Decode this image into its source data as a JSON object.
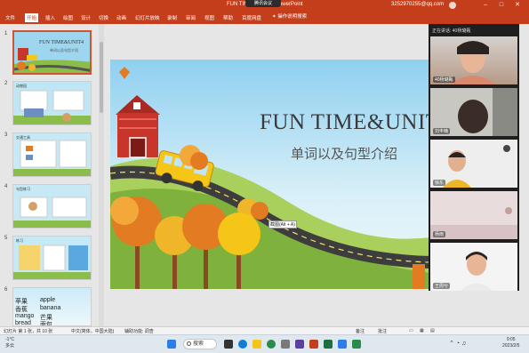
{
  "window": {
    "title": "FUN TIME&UNIT4 - PowerPoint",
    "user": "3252970255@qq.com"
  },
  "meeting": {
    "label": "腾讯会议"
  },
  "ribbon": {
    "tabs": [
      "文件",
      "开始",
      "插入",
      "绘图",
      "设计",
      "切换",
      "动画",
      "幻灯片放映",
      "录制",
      "审阅",
      "视图",
      "帮助",
      "百度网盘"
    ],
    "active_tab": "开始",
    "search": "操作说明搜索"
  },
  "thumbnails": [
    {
      "num": "1",
      "title": "FUN TIME&UNIT4",
      "subtitle": "单词以及句型介绍"
    },
    {
      "num": "2",
      "title": "动物园"
    },
    {
      "num": "3",
      "title": "交通工具"
    },
    {
      "num": "4",
      "title": "句型练习"
    },
    {
      "num": "5",
      "title": "练习"
    },
    {
      "num": "6",
      "words": [
        "苹果",
        "apple",
        "香蕉",
        "banana",
        "mango",
        "芒果",
        "bread",
        "面包"
      ]
    }
  ],
  "slide": {
    "title": "FUN TIME&UNIT4",
    "subtitle": "单词以及句型介绍",
    "tooltip": "截图(Alt + A)"
  },
  "video": {
    "speaker": "正在讲话: 40杨璐甄",
    "participants": [
      {
        "name": "40杨璐甄"
      },
      {
        "name": "刘丰楠"
      },
      {
        "name": "徐东"
      },
      {
        "name": "杨雨"
      },
      {
        "name": "王周兮"
      }
    ]
  },
  "status": {
    "slide_info": "幻灯片 第 1 张，共 10 张",
    "language": "中文(简体，中国大陆)",
    "accessibility": "辅助功能: 调查",
    "notes": "备注",
    "comments": "批注"
  },
  "taskbar": {
    "weather_temp": "-1°C",
    "weather_desc": "多云",
    "search": "搜索",
    "time": "9:05",
    "date": "2023/2/5"
  },
  "colors": {
    "accent": "#c43e1c",
    "selected_thumb": "#d35230",
    "slide_sky": "#8fd0f0",
    "barn": "#c8352b",
    "bus": "#f5c518"
  }
}
